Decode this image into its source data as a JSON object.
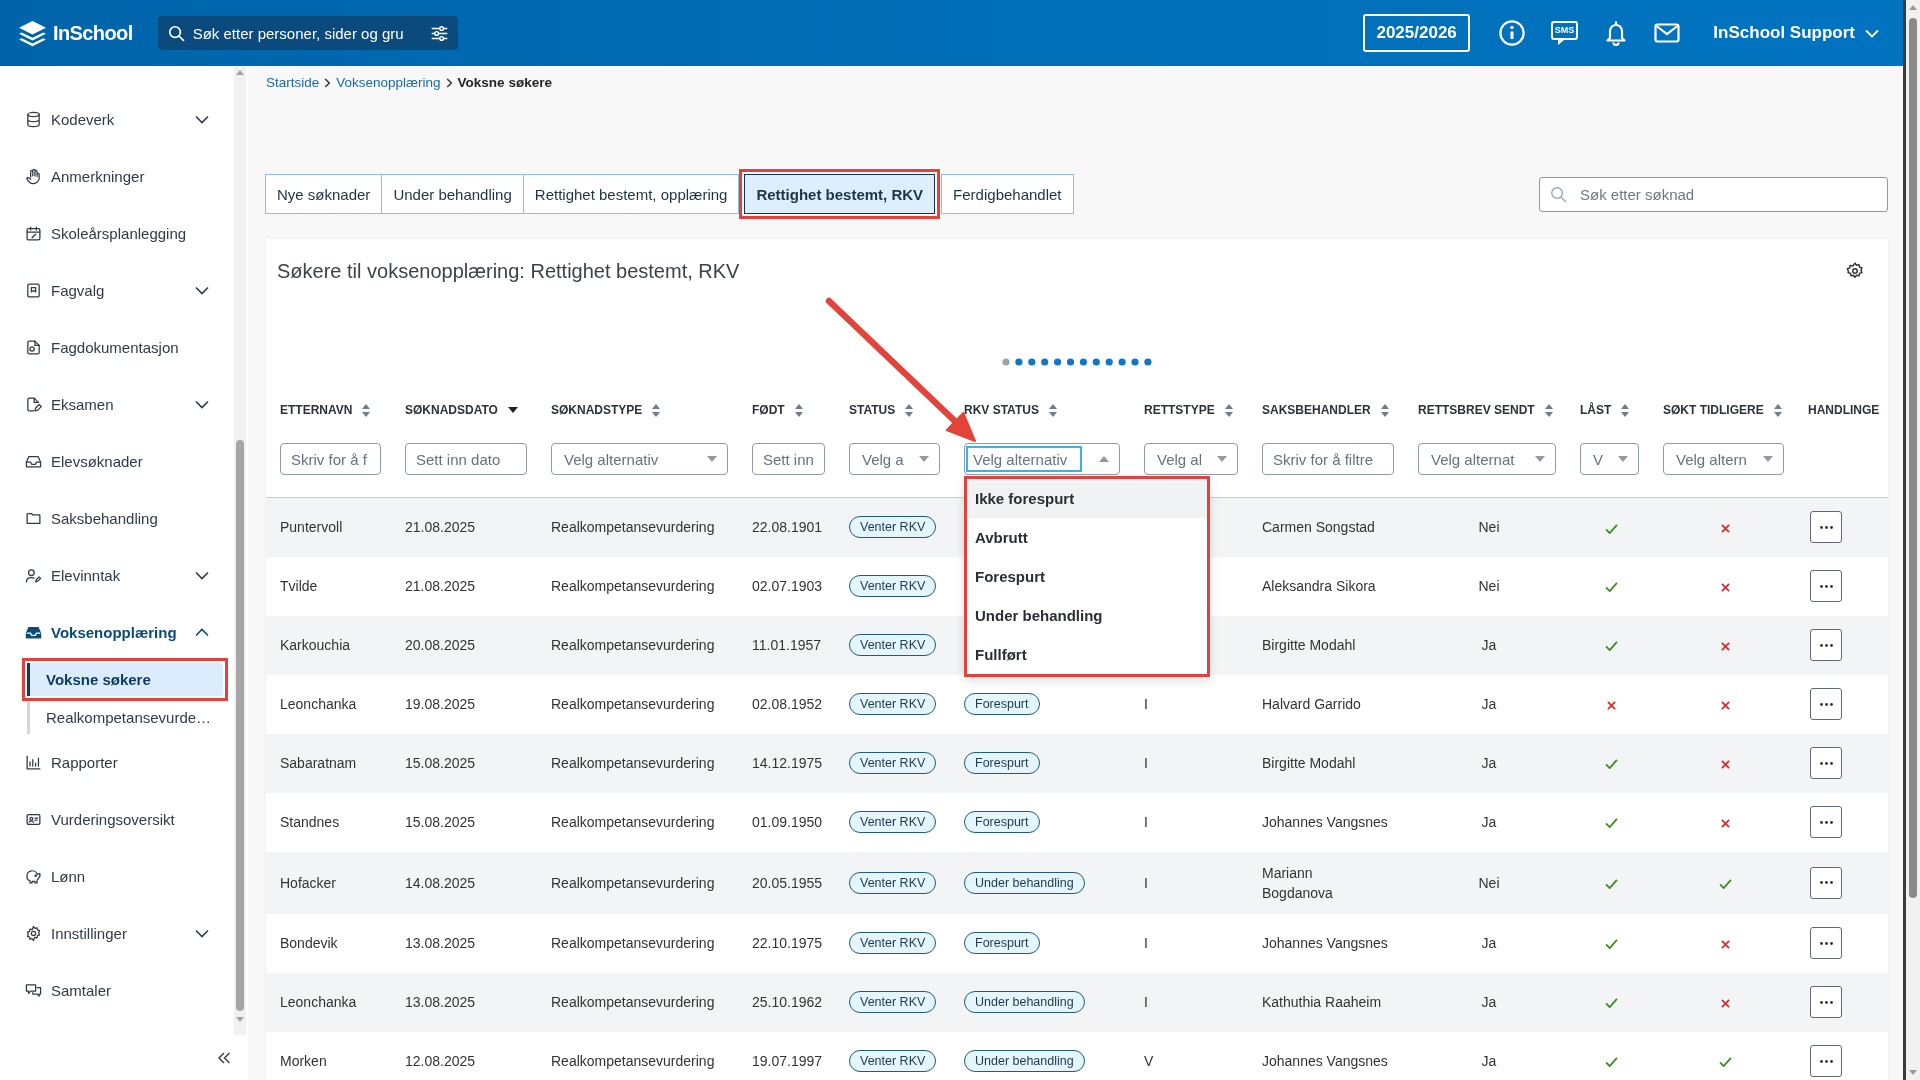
{
  "header": {
    "logo_text": "InSchool",
    "search": {
      "placeholder": "Søk etter personer, sider og gru"
    },
    "school_year": "2025/2026",
    "sms_label": "SMS",
    "user": "InSchool Support"
  },
  "sidebar": {
    "items": [
      {
        "label": "Kodeverk",
        "kind": "group",
        "expanded": false,
        "active": false
      },
      {
        "label": "Anmerkninger",
        "kind": "link",
        "active": false
      },
      {
        "label": "Skoleårsplanlegging",
        "kind": "link",
        "active": false
      },
      {
        "label": "Fagvalg",
        "kind": "group",
        "expanded": false,
        "active": false
      },
      {
        "label": "Fagdokumentasjon",
        "kind": "link",
        "active": false
      },
      {
        "label": "Eksamen",
        "kind": "group",
        "expanded": false,
        "active": false
      },
      {
        "label": "Elevsøknader",
        "kind": "link",
        "active": false
      },
      {
        "label": "Saksbehandling",
        "kind": "link",
        "active": false
      },
      {
        "label": "Elevinntak",
        "kind": "group",
        "expanded": false,
        "active": false
      },
      {
        "label": "Voksenopplæring",
        "kind": "group",
        "expanded": true,
        "active": true,
        "children": [
          {
            "label": "Voksne søkere",
            "selected": true,
            "marked": true
          },
          {
            "label": "Realkompetansevurde…",
            "selected": false,
            "marked": false
          }
        ]
      },
      {
        "label": "Rapporter",
        "kind": "link",
        "active": false
      },
      {
        "label": "Vurderingsoversikt",
        "kind": "link",
        "active": false
      },
      {
        "label": "Lønn",
        "kind": "link",
        "active": false
      },
      {
        "label": "Innstillinger",
        "kind": "group",
        "expanded": false,
        "active": false
      },
      {
        "label": "Samtaler",
        "kind": "link",
        "active": false
      }
    ]
  },
  "breadcrumb": [
    {
      "label": "Startside",
      "kind": "link"
    },
    {
      "label": "Voksenopplæring",
      "kind": "link"
    },
    {
      "label": "Voksne søkere",
      "kind": "current"
    }
  ],
  "tabs": [
    {
      "label": "Nye søknader",
      "selected": false,
      "marked": false
    },
    {
      "label": "Under behandling",
      "selected": false,
      "marked": false
    },
    {
      "label": "Rettighet bestemt, opplæring",
      "selected": false,
      "marked": false
    },
    {
      "label": "Rettighet bestemt, RKV",
      "selected": true,
      "marked": true
    },
    {
      "label": "Ferdigbehandlet",
      "selected": false,
      "marked": false
    }
  ],
  "search": {
    "placeholder": "Søk etter søknad"
  },
  "card": {
    "title": "Søkere til voksenopplæring: Rettighet bestemt, RKV",
    "loading": true
  },
  "annotation_arrow": true,
  "table": {
    "columns": [
      {
        "label": "ETTERNAVN",
        "sorted": false,
        "filter": {
          "kind": "text",
          "placeholder": "Skriv for å f"
        }
      },
      {
        "label": "SØKNADSDATO",
        "sorted": true,
        "filter": {
          "kind": "text",
          "placeholder": "Sett inn dato"
        }
      },
      {
        "label": "SØKNADSTYPE",
        "sorted": false,
        "filter": {
          "kind": "select",
          "placeholder": "Velg alternativ",
          "open": false
        }
      },
      {
        "label": "FØDT",
        "sorted": false,
        "filter": {
          "kind": "text",
          "placeholder": "Sett inn"
        }
      },
      {
        "label": "STATUS",
        "sorted": false,
        "filter": {
          "kind": "select",
          "placeholder": "Velg a",
          "open": false
        }
      },
      {
        "label": "RKV STATUS",
        "sorted": false,
        "filter": {
          "kind": "select",
          "placeholder": "Velg alternativ",
          "open": true,
          "menu": {
            "marked": true,
            "options": [
              {
                "label": "Ikke forespurt",
                "highlighted": true
              },
              {
                "label": "Avbrutt",
                "highlighted": false
              },
              {
                "label": "Forespurt",
                "highlighted": false
              },
              {
                "label": "Under behandling",
                "highlighted": false
              },
              {
                "label": "Fullført",
                "highlighted": false
              }
            ]
          }
        }
      },
      {
        "label": "RETTSTYPE",
        "sorted": false,
        "filter": {
          "kind": "select",
          "placeholder": "Velg al",
          "open": false
        }
      },
      {
        "label": "SAKSBEHANDLER",
        "sorted": false,
        "filter": {
          "kind": "text",
          "placeholder": "Skriv for å filtre"
        }
      },
      {
        "label": "RETTSBREV SENDT",
        "sorted": false,
        "filter": {
          "kind": "select",
          "placeholder": "Velg alternat",
          "open": false
        }
      },
      {
        "label": "LÅST",
        "sorted": false,
        "filter": {
          "kind": "select",
          "placeholder": "V",
          "open": false
        }
      },
      {
        "label": "SØKT TIDLIGERE",
        "sorted": false,
        "filter": {
          "kind": "select",
          "placeholder": "Velg altern",
          "open": false
        }
      },
      {
        "label": "HANDLINGE"
      }
    ],
    "rows": [
      {
        "last_name": "Puntervoll",
        "application_date": "21.08.2025",
        "application_type": "Realkompetansevurdering",
        "born": "22.08.1901",
        "status": "Venter RKV",
        "caseworker": "Carmen Songstad",
        "letter_sent": "Nei",
        "locked": true,
        "applied_before": false
      },
      {
        "last_name": "Tvilde",
        "application_date": "21.08.2025",
        "application_type": "Realkompetansevurdering",
        "born": "02.07.1903",
        "status": "Venter RKV",
        "caseworker": "Aleksandra Sikora",
        "letter_sent": "Nei",
        "locked": true,
        "applied_before": false
      },
      {
        "last_name": "Karkouchia",
        "application_date": "20.08.2025",
        "application_type": "Realkompetansevurdering",
        "born": "11.01.1957",
        "status": "Venter RKV",
        "caseworker": "Birgitte Modahl",
        "letter_sent": "Ja",
        "locked": true,
        "applied_before": false
      },
      {
        "last_name": "Leonchanka",
        "application_date": "19.08.2025",
        "application_type": "Realkompetansevurdering",
        "born": "02.08.1952",
        "status": "Venter RKV",
        "rkv_status": "Forespurt",
        "right_type": "I",
        "caseworker": "Halvard Garrido",
        "letter_sent": "Ja",
        "locked": false,
        "applied_before": false
      },
      {
        "last_name": "Sabaratnam",
        "application_date": "15.08.2025",
        "application_type": "Realkompetansevurdering",
        "born": "14.12.1975",
        "status": "Venter RKV",
        "rkv_status": "Forespurt",
        "right_type": "I",
        "caseworker": "Birgitte Modahl",
        "letter_sent": "Ja",
        "locked": true,
        "applied_before": false
      },
      {
        "last_name": "Standnes",
        "application_date": "15.08.2025",
        "application_type": "Realkompetansevurdering",
        "born": "01.09.1950",
        "status": "Venter RKV",
        "rkv_status": "Forespurt",
        "right_type": "I",
        "caseworker": "Johannes Vangsnes",
        "letter_sent": "Ja",
        "locked": true,
        "applied_before": false
      },
      {
        "last_name": "Hofacker",
        "application_date": "14.08.2025",
        "application_type": "Realkompetansevurdering",
        "born": "20.05.1955",
        "status": "Venter RKV",
        "rkv_status": "Under behandling",
        "right_type": "I",
        "caseworker": "Mariann\nBogdanova",
        "letter_sent": "Nei",
        "locked": true,
        "applied_before": true
      },
      {
        "last_name": "Bondevik",
        "application_date": "13.08.2025",
        "application_type": "Realkompetansevurdering",
        "born": "22.10.1975",
        "status": "Venter RKV",
        "rkv_status": "Forespurt",
        "right_type": "I",
        "caseworker": "Johannes Vangsnes",
        "letter_sent": "Ja",
        "locked": true,
        "applied_before": false
      },
      {
        "last_name": "Leonchanka",
        "application_date": "13.08.2025",
        "application_type": "Realkompetansevurdering",
        "born": "25.10.1962",
        "status": "Venter RKV",
        "rkv_status": "Under behandling",
        "right_type": "I",
        "caseworker": "Kathuthia Raaheim",
        "letter_sent": "Ja",
        "locked": true,
        "applied_before": false
      },
      {
        "last_name": "Morken",
        "application_date": "12.08.2025",
        "application_type": "Realkompetansevurdering",
        "born": "19.07.1997",
        "status": "Venter RKV",
        "rkv_status": "Under behandling",
        "right_type": "V",
        "caseworker": "Johannes Vangsnes",
        "letter_sent": "Ja",
        "locked": true,
        "applied_before": true
      }
    ]
  }
}
